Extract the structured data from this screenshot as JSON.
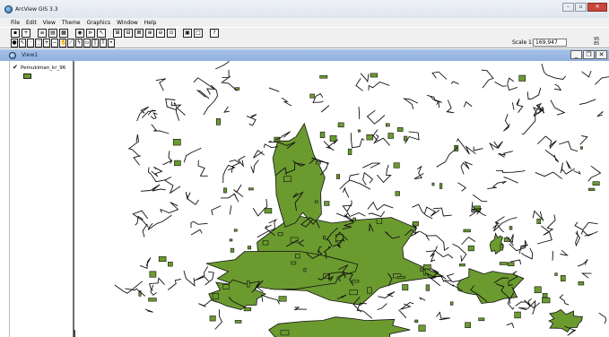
{
  "app": {
    "title": "ArcView GIS 3.3"
  },
  "menu": {
    "items": [
      "File",
      "Edit",
      "View",
      "Theme",
      "Graphics",
      "Window",
      "Help"
    ]
  },
  "toolbar": {
    "scale_label": "Scale 1:",
    "scale_value": "169,947",
    "coordinate_readout": [
      "95",
      "85"
    ]
  },
  "view_window": {
    "title": "View1"
  },
  "toc": {
    "themes": [
      {
        "name": "Pemukiman_kr_96",
        "visible": true,
        "color": "#6b9a2f"
      }
    ]
  },
  "map": {
    "fill_color": "#6b9a2f",
    "line_color": "#111111"
  }
}
